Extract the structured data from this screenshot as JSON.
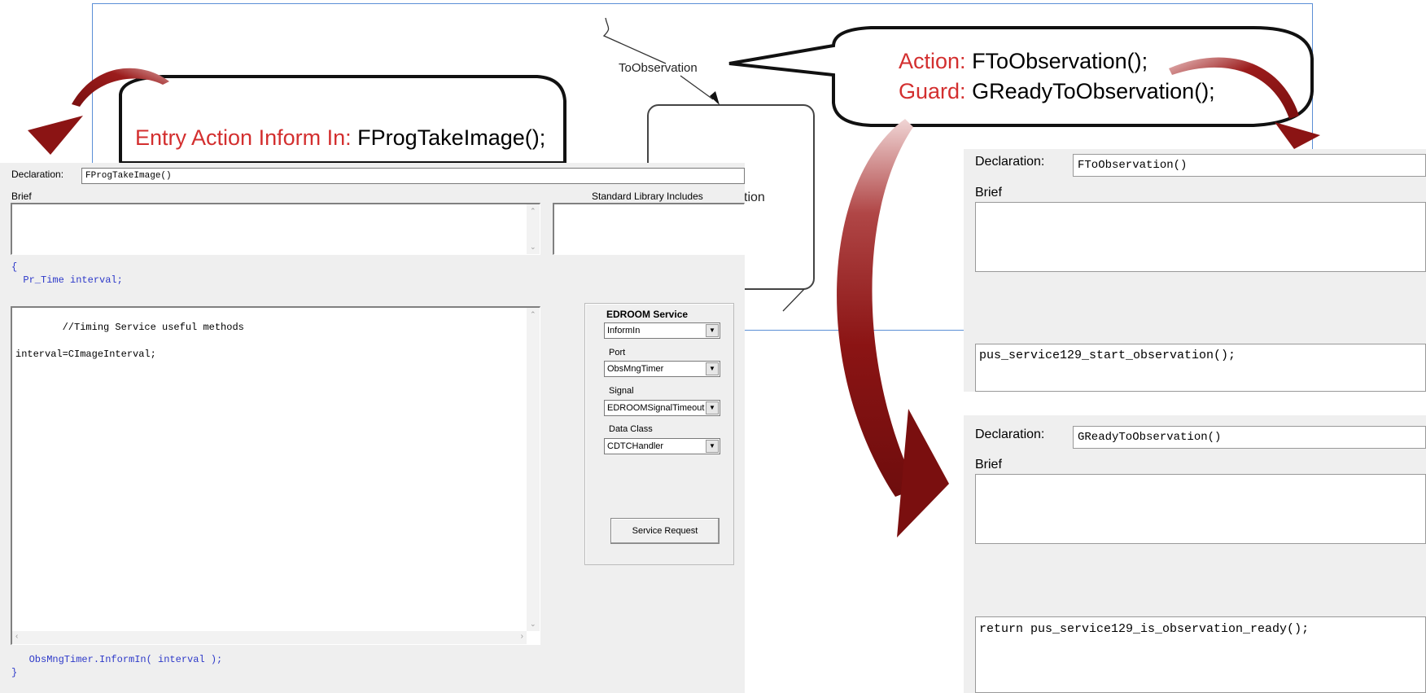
{
  "diagram": {
    "transition_label": "ToObservation",
    "state_partial_label": "tion",
    "entry_callout": {
      "label": "Entry Action Inform In:",
      "value": "FProgTakeImage();"
    },
    "transition_callout": {
      "action_label": "Action:",
      "action_value": "FToObservation();",
      "guard_label": "Guard:",
      "guard_value": "GReadyToObservation();"
    },
    "colors": {
      "arrow": "#8b1a1a",
      "label_red": "#d32f2f",
      "frame": "#5b8fd6"
    }
  },
  "entry_dialog": {
    "declaration_label": "Declaration:",
    "declaration_value": "FProgTakeImage()",
    "brief_label": "Brief",
    "std_lib_label": "Standard Library Includes",
    "header_code_1": "{",
    "header_code_2": "  Pr_Time interval;",
    "body_code_1": "        //Timing Service useful methods",
    "body_code_2": "interval=CImageInterval;",
    "footer_code_1": "   ObsMngTimer.InformIn( interval );",
    "footer_code_2": "}",
    "service": {
      "title": "EDROOM Service",
      "service_value": "InformIn",
      "port_label": "Port",
      "port_value": "ObsMngTimer",
      "signal_label": "Signal",
      "signal_value": "EDROOMSignalTimeout",
      "data_class_label": "Data Class",
      "data_class_value": "CDTCHandler",
      "request_button": "Service Request"
    }
  },
  "action_dialog": {
    "declaration_label": "Declaration:",
    "declaration_value": "FToObservation()",
    "brief_label": "Brief",
    "code": "pus_service129_start_observation();"
  },
  "guard_dialog": {
    "declaration_label": "Declaration:",
    "declaration_value": "GReadyToObservation()",
    "brief_label": "Brief",
    "code": "return pus_service129_is_observation_ready();"
  }
}
